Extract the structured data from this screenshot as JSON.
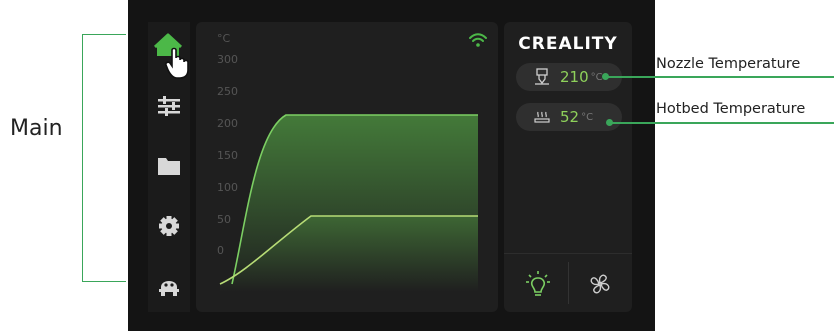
{
  "annotation": {
    "main_label": "Main",
    "nozzle_label": "Nozzle Temperature",
    "hotbed_label": "Hotbed Temperature"
  },
  "sidebar": {
    "items": [
      {
        "name": "home",
        "icon": "home-icon",
        "active": true
      },
      {
        "name": "controls",
        "icon": "sliders-icon"
      },
      {
        "name": "files",
        "icon": "folder-icon"
      },
      {
        "name": "settings",
        "icon": "gear-icon"
      },
      {
        "name": "robot",
        "icon": "robot-icon"
      }
    ]
  },
  "chart": {
    "unit": "°C",
    "y_ticks": [
      "300",
      "250",
      "200",
      "150",
      "100",
      "50",
      "0"
    ],
    "wifi_icon": "wifi-icon"
  },
  "chart_data": {
    "type": "area",
    "ylabel": "°C",
    "ylim": [
      0,
      300
    ],
    "series": [
      {
        "color": "#7ccf63"
      },
      {
        "color": "#b7dc76"
      }
    ]
  },
  "status": {
    "brand": "CREALITY",
    "nozzle": {
      "value": "210",
      "unit": "°C",
      "icon": "nozzle-icon"
    },
    "hotbed": {
      "value": "52",
      "unit": "°C",
      "icon": "hotbed-icon"
    },
    "light_icon": "light-bulb-icon",
    "fan_icon": "fan-icon"
  },
  "colors": {
    "accent": "#4cb848",
    "value_green": "#8ed15b",
    "callout_green": "#3aa65a",
    "screen_bg": "#141414"
  }
}
